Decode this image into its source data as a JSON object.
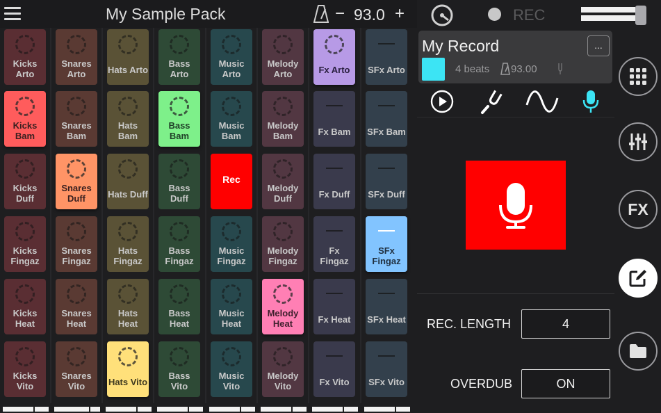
{
  "header": {
    "title": "My Sample Pack",
    "bpm_minus": "−",
    "bpm_value": "93.0",
    "bpm_plus": "+"
  },
  "recorder": {
    "rec_label": "REC",
    "record_name": "My Record",
    "more_label": "...",
    "beats": "4 beats",
    "bpm": "93.00",
    "accent_color": "#3ce4f4",
    "rec_length_label": "REC. LENGTH",
    "rec_length_value": "4",
    "overdub_label": "OVERDUB",
    "overdub_value": "ON"
  },
  "side_buttons": [
    {
      "name": "pads-grid-button",
      "icon": "grid-icon"
    },
    {
      "name": "mixer-button",
      "icon": "sliders-icon"
    },
    {
      "name": "fx-button",
      "label": "FX"
    },
    {
      "name": "edit-button",
      "icon": "edit-icon",
      "active": true
    },
    {
      "name": "folder-button",
      "icon": "folder-icon"
    }
  ],
  "pads": [
    [
      {
        "label": "Kicks\nArto"
      },
      {
        "label": "Kicks\nBam",
        "lit": true
      },
      {
        "label": "Kicks\nDuff"
      },
      {
        "label": "Kicks\nFingaz"
      },
      {
        "label": "Kicks\nHeat"
      },
      {
        "label": "Kicks\nVito"
      }
    ],
    [
      {
        "label": "Snares\nArto"
      },
      {
        "label": "Snares\nBam"
      },
      {
        "label": "Snares\nDuff",
        "lit": true
      },
      {
        "label": "Snares\nFingaz"
      },
      {
        "label": "Snares\nHeat"
      },
      {
        "label": "Snares\nVito"
      }
    ],
    [
      {
        "label": "Hats Arto"
      },
      {
        "label": "Hats\nBam"
      },
      {
        "label": "Hats Duff"
      },
      {
        "label": "Hats\nFingaz"
      },
      {
        "label": "Hats\nHeat"
      },
      {
        "label": "Hats Vito",
        "lit": true
      }
    ],
    [
      {
        "label": "Bass\nArto"
      },
      {
        "label": "Bass\nBam",
        "lit": true
      },
      {
        "label": "Bass\nDuff"
      },
      {
        "label": "Bass\nFingaz"
      },
      {
        "label": "Bass\nHeat"
      },
      {
        "label": "Bass\nVito"
      }
    ],
    [
      {
        "label": "Music\nArto"
      },
      {
        "label": "Music\nBam"
      },
      {
        "label": "Rec",
        "rec": true
      },
      {
        "label": "Music\nFingaz"
      },
      {
        "label": "Music\nHeat"
      },
      {
        "label": "Music\nVito"
      }
    ],
    [
      {
        "label": "Melody\nArto"
      },
      {
        "label": "Melody\nBam"
      },
      {
        "label": "Melody\nDuff"
      },
      {
        "label": "Melody\nFingaz"
      },
      {
        "label": "Melody\nHeat",
        "lit": true
      },
      {
        "label": "Melody\nVito"
      }
    ],
    [
      {
        "label": "Fx Arto",
        "lit": true
      },
      {
        "label": "Fx Bam"
      },
      {
        "label": "Fx Duff"
      },
      {
        "label": "Fx\nFingaz"
      },
      {
        "label": "Fx Heat"
      },
      {
        "label": "Fx Vito"
      }
    ],
    [
      {
        "label": "SFx Arto"
      },
      {
        "label": "SFx Bam"
      },
      {
        "label": "SFx Duff"
      },
      {
        "label": "SFx\nFingaz",
        "lit": true
      },
      {
        "label": "SFx Heat"
      },
      {
        "label": "SFx Vito"
      }
    ]
  ],
  "colors": {
    "columns": [
      "#5a2e33",
      "#5a3a33",
      "#5a5236",
      "#2e4a36",
      "#27484d",
      "#523742",
      "#3a3a4c",
      "#33404c"
    ],
    "lit": [
      "#ff5c5c",
      "#ff9466",
      "#ffe07a",
      "#7ef08a",
      "#ff0000",
      "#ff7fb4",
      "#b79ae6",
      "#82c4ff"
    ],
    "rec_button": "#ff0000",
    "mic_active": "#3ce4f4"
  }
}
